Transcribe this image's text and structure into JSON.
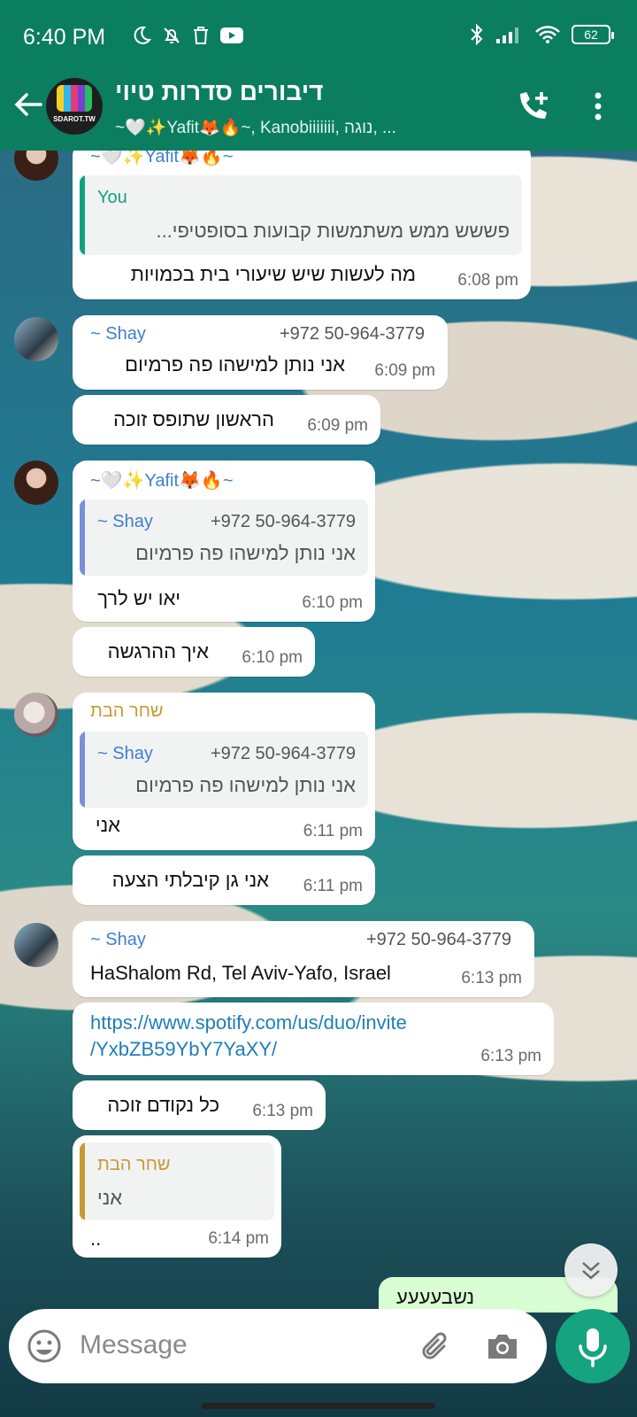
{
  "status_bar": {
    "time": "6:40 PM",
    "battery": "62"
  },
  "header": {
    "group_avatar_label": "SDAROT.TW",
    "title": "דיבורים סדרות טיוי",
    "subtitle": "~🤍✨Yafit🦊🔥~, Kanobiiiiiii, נוגה, ..."
  },
  "messages": [
    {
      "sender": "~🤍✨Yafit🦊🔥~",
      "quote_sender": "You",
      "quote_text": "פששש ממש משתמשות קבועות בסופטיפי...",
      "text": "מה לעשות שיש שיעורי בית בכמויות",
      "time": "6:08 pm"
    },
    {
      "sender": "~ Shay",
      "phone": "+972 50-964-3779",
      "text": "אני נותן למישהו פה פרמיום",
      "time": "6:09 pm"
    },
    {
      "text": "הראשון שתופס זוכה",
      "time": "6:09 pm"
    },
    {
      "sender": "~🤍✨Yafit🦊🔥~",
      "quote_sender": "~ Shay",
      "quote_phone": "+972 50-964-3779",
      "quote_text": "אני נותן למישהו פה פרמיום",
      "text": "יאו יש לרך",
      "time": "6:10 pm"
    },
    {
      "text": "איך ההרגשה",
      "time": "6:10 pm"
    },
    {
      "sender": "שחר הבת",
      "quote_sender": "~ Shay",
      "quote_phone": "+972 50-964-3779",
      "quote_text": "אני נותן למישהו פה פרמיום",
      "text": "אני",
      "time": "6:11 pm"
    },
    {
      "text": "אני גן קיבלתי הצעה",
      "time": "6:11 pm"
    },
    {
      "sender": "~ Shay",
      "phone": "+972 50-964-3779",
      "text": "HaShalom Rd, Tel Aviv-Yafo, Israel",
      "time": "6:13 pm"
    },
    {
      "link_line1": "https://www.spotify.com/us/duo/invite",
      "link_line2": "/YxbZB59YbY7YaXY/",
      "time": "6:13 pm"
    },
    {
      "text": "כל נקודם זוכה",
      "time": "6:13 pm"
    },
    {
      "quote_sender": "שחר הבת",
      "quote_text": "אני",
      "text": "..",
      "time": "6:14 pm"
    }
  ],
  "outgoing_partial": "נשבעעעע",
  "composer": {
    "placeholder": "Message"
  },
  "colors": {
    "header": "#0b7e5f",
    "mic": "#16a37f",
    "link": "#1d7fb8",
    "gold_name": "#c49a34",
    "blue_name": "#3f7fd0"
  }
}
